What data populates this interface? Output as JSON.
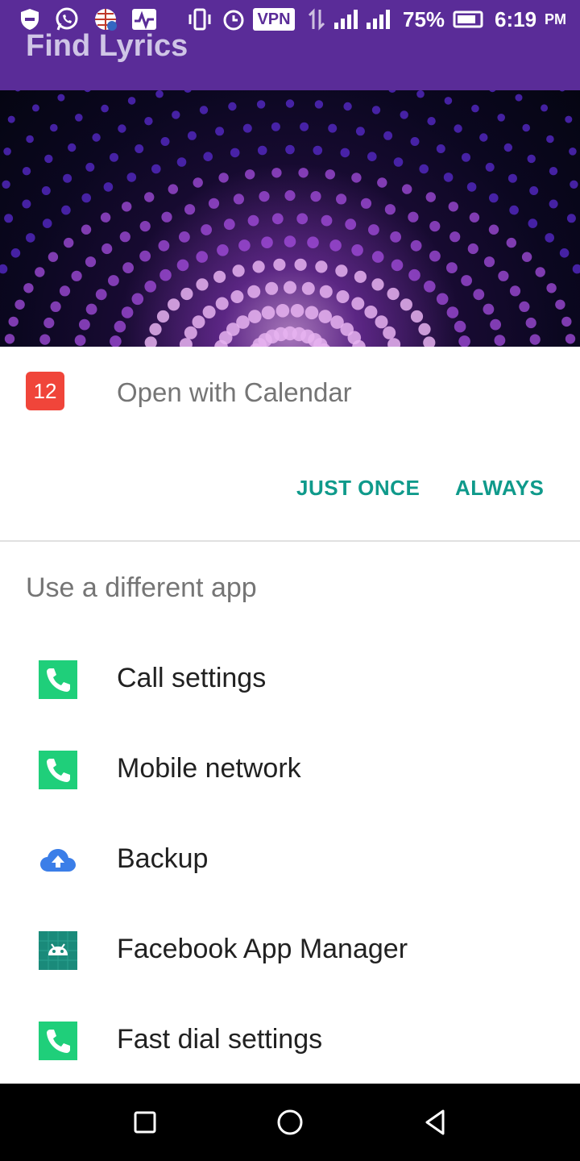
{
  "status_bar": {
    "battery_percent": "75%",
    "time": "6:19",
    "ampm": "PM",
    "vpn_label": "VPN"
  },
  "app_bar": {
    "title": "Find Lyrics"
  },
  "dialog": {
    "default_app_badge": "12",
    "open_with_text": "Open with Calendar",
    "just_once_label": "JUST ONCE",
    "always_label": "ALWAYS",
    "different_app_label": "Use a different app",
    "apps": [
      {
        "label": "Call settings",
        "icon": "phone-icon"
      },
      {
        "label": "Mobile network",
        "icon": "phone-icon"
      },
      {
        "label": "Backup",
        "icon": "cloud-upload-icon"
      },
      {
        "label": "Facebook App Manager",
        "icon": "android-icon"
      },
      {
        "label": "Fast dial settings",
        "icon": "phone-icon"
      }
    ]
  },
  "colors": {
    "app_bar": "#5a2c98",
    "accent": "#0f9a8b",
    "calendar_icon": "#f0453a",
    "phone_icon": "#1fcf7a"
  }
}
